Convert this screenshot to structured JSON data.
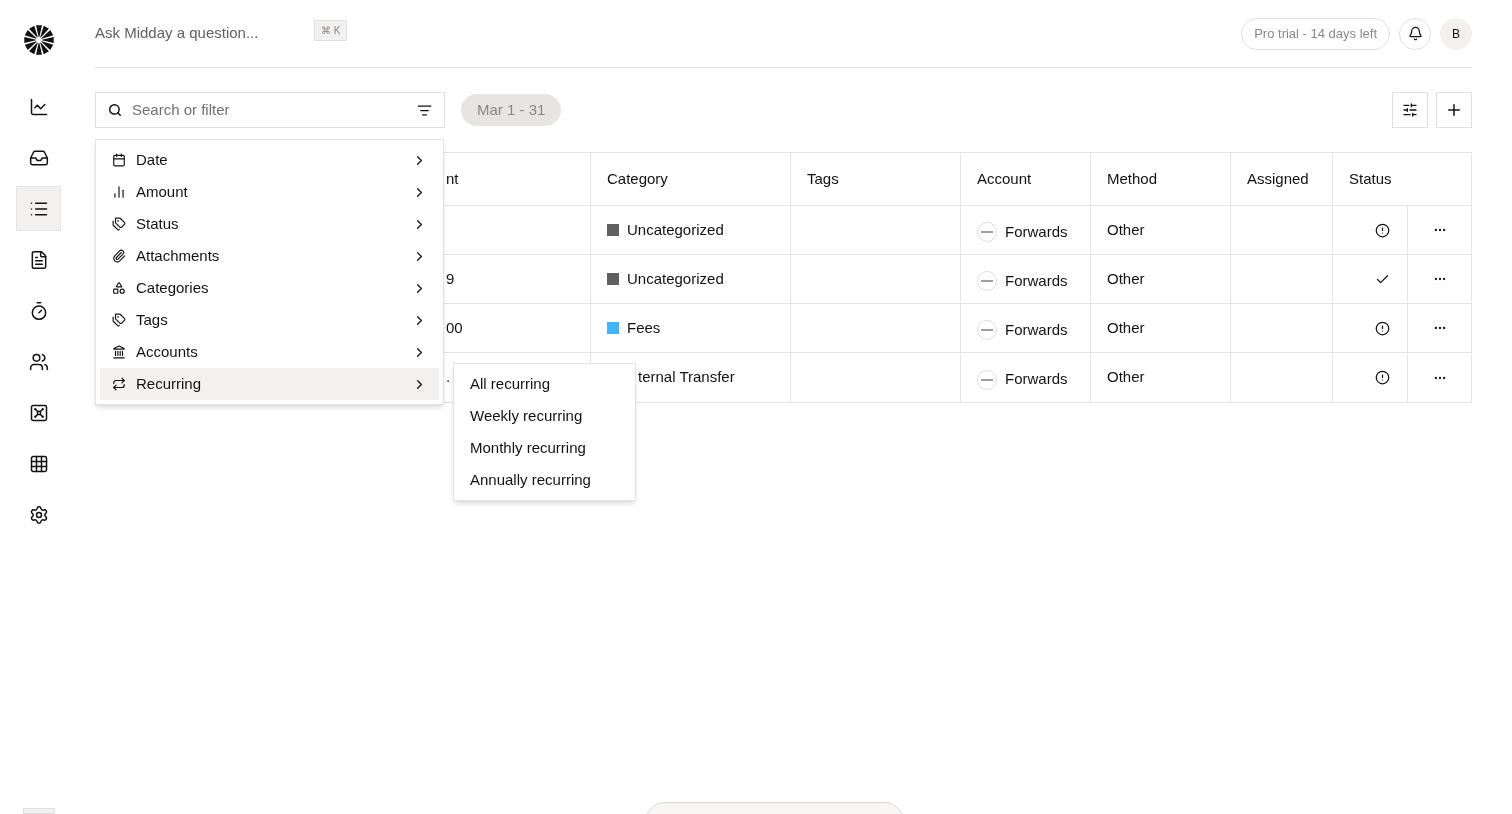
{
  "sidebar": {
    "items": [
      {
        "kind": "chart",
        "selected": false
      },
      {
        "kind": "inbox",
        "selected": false
      },
      {
        "kind": "transactions",
        "selected": true
      },
      {
        "kind": "invoice",
        "selected": false
      },
      {
        "kind": "timer",
        "selected": false
      },
      {
        "kind": "people",
        "selected": false
      },
      {
        "kind": "vault",
        "selected": false
      },
      {
        "kind": "apps",
        "selected": false
      },
      {
        "kind": "settings",
        "selected": false
      }
    ]
  },
  "header": {
    "ask_placeholder": "Ask Midday a question...",
    "shortcut": "⌘ K",
    "trial": "Pro trial - 14 days left",
    "avatar": "B"
  },
  "toolbar": {
    "search_placeholder": "Search or filter",
    "date_range": "Mar 1 - 31"
  },
  "table": {
    "columns": [
      "nt",
      "Category",
      "Tags",
      "Account",
      "Method",
      "Assigned",
      "Status"
    ],
    "rows": [
      {
        "amount": "",
        "category": "Uncategorized",
        "color": "#606060",
        "account": "Forwards",
        "method": "Other",
        "done": false
      },
      {
        "amount": "9",
        "category": "Uncategorized",
        "color": "#606060",
        "account": "Forwards",
        "method": "Other",
        "done": true
      },
      {
        "amount": "00",
        "category": "Fees",
        "color": "#3db6ff",
        "account": "Forwards",
        "method": "Other",
        "done": false
      },
      {
        "amount": ".",
        "category": "ternal Transfer",
        "account": "Forwards",
        "method": "Other",
        "done": false
      }
    ]
  },
  "filter_menu": {
    "items": [
      {
        "kind": "date",
        "label": "Date",
        "selected": false
      },
      {
        "kind": "amount",
        "label": "Amount",
        "selected": false
      },
      {
        "kind": "status",
        "label": "Status",
        "selected": false
      },
      {
        "kind": "attachments",
        "label": "Attachments",
        "selected": false
      },
      {
        "kind": "categories",
        "label": "Categories",
        "selected": false
      },
      {
        "kind": "tags",
        "label": "Tags",
        "selected": false
      },
      {
        "kind": "accounts",
        "label": "Accounts",
        "selected": false
      },
      {
        "kind": "recurring",
        "label": "Recurring",
        "selected": true
      }
    ]
  },
  "submenu": {
    "items": [
      "All recurring",
      "Weekly recurring",
      "Monthly recurring",
      "Annually recurring"
    ]
  }
}
